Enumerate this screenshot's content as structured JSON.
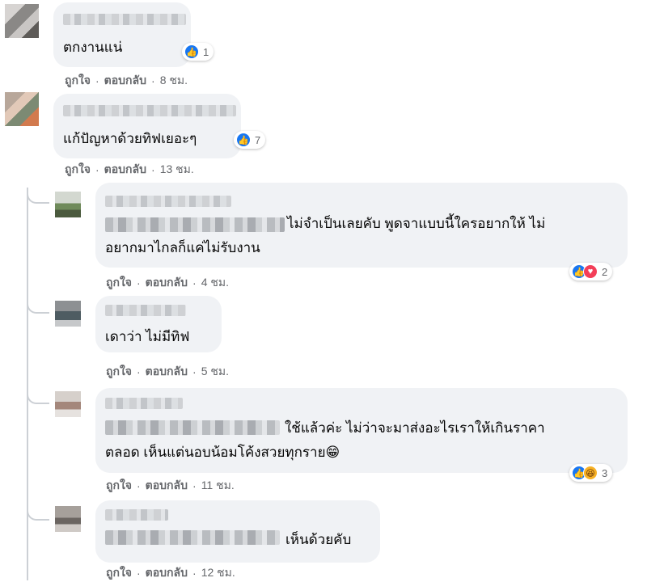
{
  "actions": {
    "like": "ถูกใจ",
    "reply": "ตอบกลับ",
    "separator": "·"
  },
  "comments": [
    {
      "text": [
        "ตกงานแน่"
      ],
      "time": "8 ชม.",
      "reactions": [
        "like"
      ],
      "count": "1"
    },
    {
      "text": [
        "แก้ปัญหาด้วยทิฟเยอะๆ"
      ],
      "time": "13 ชม.",
      "reactions": [
        "like"
      ],
      "count": "7"
    },
    {
      "text": [
        "ไม่จำเป็นเลยคับ พูดจาแบบนี้ใครอยากให้ ไม่",
        "อยากมาไกลก็แค่ไม่รับงาน"
      ],
      "time": "4 ชม.",
      "reactions": [
        "like",
        "love"
      ],
      "count": "2"
    },
    {
      "text": [
        "เดาว่า ไม่มีทิฟ"
      ],
      "time": "5 ชม.",
      "reactions": [],
      "count": ""
    },
    {
      "text": [
        "ใช้แล้วค่ะ ไม่ว่าจะมาส่งอะไรเราให้เกินราคา",
        "ตลอด เห็นแต่นอบน้อมโค้งสวยทุกราย😁"
      ],
      "time": "11 ชม.",
      "reactions": [
        "like",
        "haha"
      ],
      "count": "3"
    },
    {
      "text": [
        "เห็นด้วยคับ"
      ],
      "time": "12 ชม.",
      "reactions": [],
      "count": ""
    }
  ],
  "icons": {
    "like": "👍",
    "love": "♥",
    "haha": "😆"
  },
  "colors": {
    "bubble": "#f0f2f5",
    "like": "#1877f2",
    "love": "#f33e58",
    "haha": "#f7b125",
    "meta": "#65676b"
  }
}
